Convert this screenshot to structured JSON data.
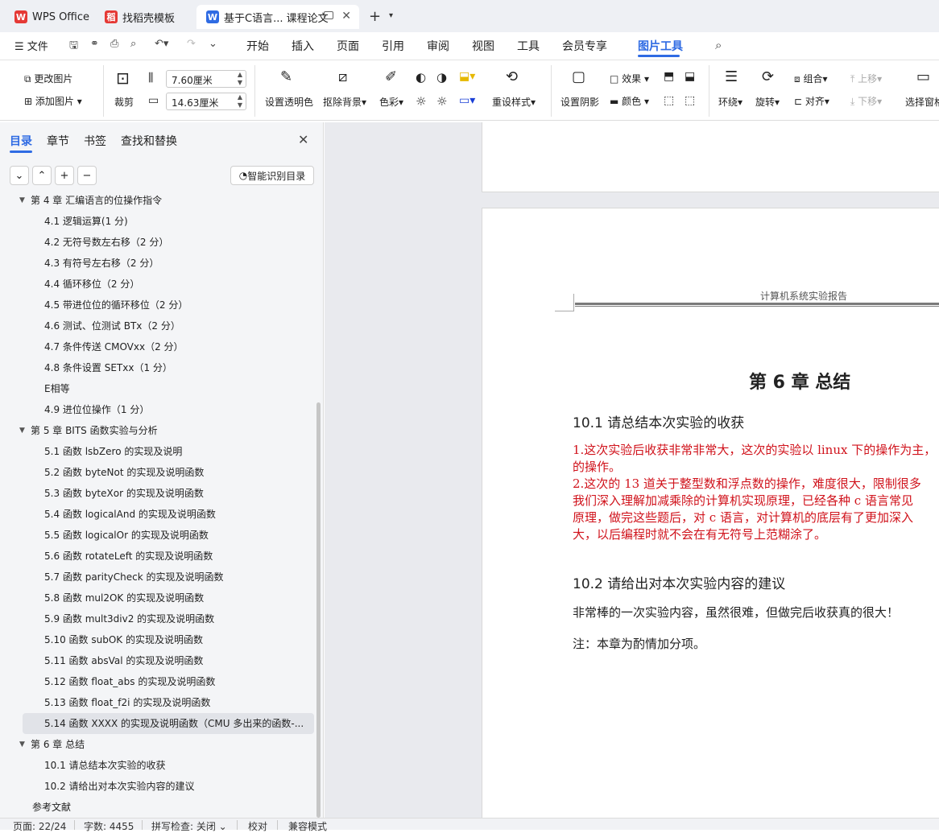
{
  "tabs": [
    {
      "label": "WPS Office",
      "icon": "wps-logo-icon",
      "color": "#e53935"
    },
    {
      "label": "找稻壳模板",
      "icon": "daoke-icon",
      "color": "#e53935"
    },
    {
      "label": "基于C语言... 课程论文",
      "icon": "word-doc-icon",
      "color": "#2f6be3"
    }
  ],
  "menubar": {
    "file": "文件",
    "items": [
      "开始",
      "插入",
      "页面",
      "引用",
      "审阅",
      "视图",
      "工具",
      "会员专享",
      "图片工具"
    ],
    "active": "图片工具"
  },
  "ribbon": {
    "change_image": "更改图片",
    "add_image": "添加图片",
    "crop": "裁剪",
    "width_value": "7.60厘米",
    "height_value": "14.63厘米",
    "set_transparent": "设置透明色",
    "remove_bg": "抠除背景",
    "color": "色彩",
    "reset_style": "重设样式",
    "shadow": "设置阴影",
    "effect": "效果",
    "fill_color": "颜色",
    "wrap": "环绕",
    "rotate": "旋转",
    "group": "组合",
    "align": "对齐",
    "move_up": "上移",
    "move_down": "下移",
    "select_pane": "选择窗格"
  },
  "sidebar": {
    "tabs": [
      "目录",
      "章节",
      "书签",
      "查找和替换"
    ],
    "smart_toc": "智能识别目录",
    "toc": [
      {
        "text": "第 4 章  汇编语言的位操作指令",
        "level": 1,
        "caret": true
      },
      {
        "text": "4.1  逻辑运算(1 分)",
        "level": 2
      },
      {
        "text": "4.2 无符号数左右移（2 分）",
        "level": 2
      },
      {
        "text": "4.3 有符号左右移（2 分）",
        "level": 2
      },
      {
        "text": "4.4 循环移位（2 分）",
        "level": 2
      },
      {
        "text": "4.5 带进位位的循环移位（2 分）",
        "level": 2
      },
      {
        "text": "4.6 测试、位测试 BTx（2 分）",
        "level": 2
      },
      {
        "text": "4.7 条件传送 CMOVxx（2 分）",
        "level": 2
      },
      {
        "text": "4.8 条件设置 SETxx（1 分）",
        "level": 2
      },
      {
        "text": "E相等",
        "level": 2
      },
      {
        "text": "4.9 进位位操作（1 分）",
        "level": 2
      },
      {
        "text": "第 5 章  BITS 函数实验与分析",
        "level": 1,
        "caret": true
      },
      {
        "text": "5.1  函数 lsbZero 的实现及说明",
        "level": 2
      },
      {
        "text": "5.2  函数 byteNot 的实现及说明函数",
        "level": 2
      },
      {
        "text": "5.3  函数 byteXor 的实现及说明函数",
        "level": 2
      },
      {
        "text": "5.4  函数 logicalAnd 的实现及说明函数",
        "level": 2
      },
      {
        "text": "5.5  函数 logicalOr 的实现及说明函数",
        "level": 2
      },
      {
        "text": "5.6  函数 rotateLeft 的实现及说明函数",
        "level": 2
      },
      {
        "text": "5.7  函数 parityCheck 的实现及说明函数",
        "level": 2
      },
      {
        "text": "5.8  函数 mul2OK 的实现及说明函数",
        "level": 2
      },
      {
        "text": "5.9  函数 mult3div2 的实现及说明函数",
        "level": 2
      },
      {
        "text": "5.10  函数 subOK 的实现及说明函数",
        "level": 2
      },
      {
        "text": "5.11  函数 absVal 的实现及说明函数",
        "level": 2
      },
      {
        "text": "5.12  函数 float_abs 的实现及说明函数",
        "level": 2
      },
      {
        "text": "5.13  函数 float_f2i 的实现及说明函数",
        "level": 2
      },
      {
        "text": "5.14 函数 XXXX 的实现及说明函数（CMU 多出来的函数-...",
        "level": 2,
        "selected": true
      },
      {
        "text": "第 6 章  总结",
        "level": 1,
        "caret": true
      },
      {
        "text": "10.1  请总结本次实验的收获",
        "level": 2
      },
      {
        "text": "10.2  请给出对本次实验内容的建议",
        "level": 2
      },
      {
        "text": "参考文献",
        "level": 0
      }
    ]
  },
  "document": {
    "header": "计算机系统实验报告",
    "chapter_title": "第 6 章  总结",
    "sec1_title": "10.1  请总结本次实验的收获",
    "sec1_lines": [
      "1.这次实验后收获非常非常大，这次的实验以 linux 下的操作为主，",
      "的操作。",
      "2.这次的 13 道关于整型数和浮点数的操作，难度很大，限制很多",
      "我们深入理解加减乘除的计算机实现原理，已经各种 c 语言常见",
      "原理，做完这些题后，对 c 语言，对计算机的底层有了更加深入",
      "大，以后编程时就不会在有无符号上范糊涂了。"
    ],
    "sec2_title": "10.2  请给出对本次实验内容的建议",
    "sec2_text": "非常棒的一次实验内容，虽然很难，但做完后收获真的很大！",
    "note": "注：本章为酌情加分项。"
  },
  "status": {
    "page": "页面: 22/24",
    "words": "字数: 4455",
    "spell": "拼写检查: 关闭",
    "proof": "校对",
    "compat": "兼容模式"
  }
}
